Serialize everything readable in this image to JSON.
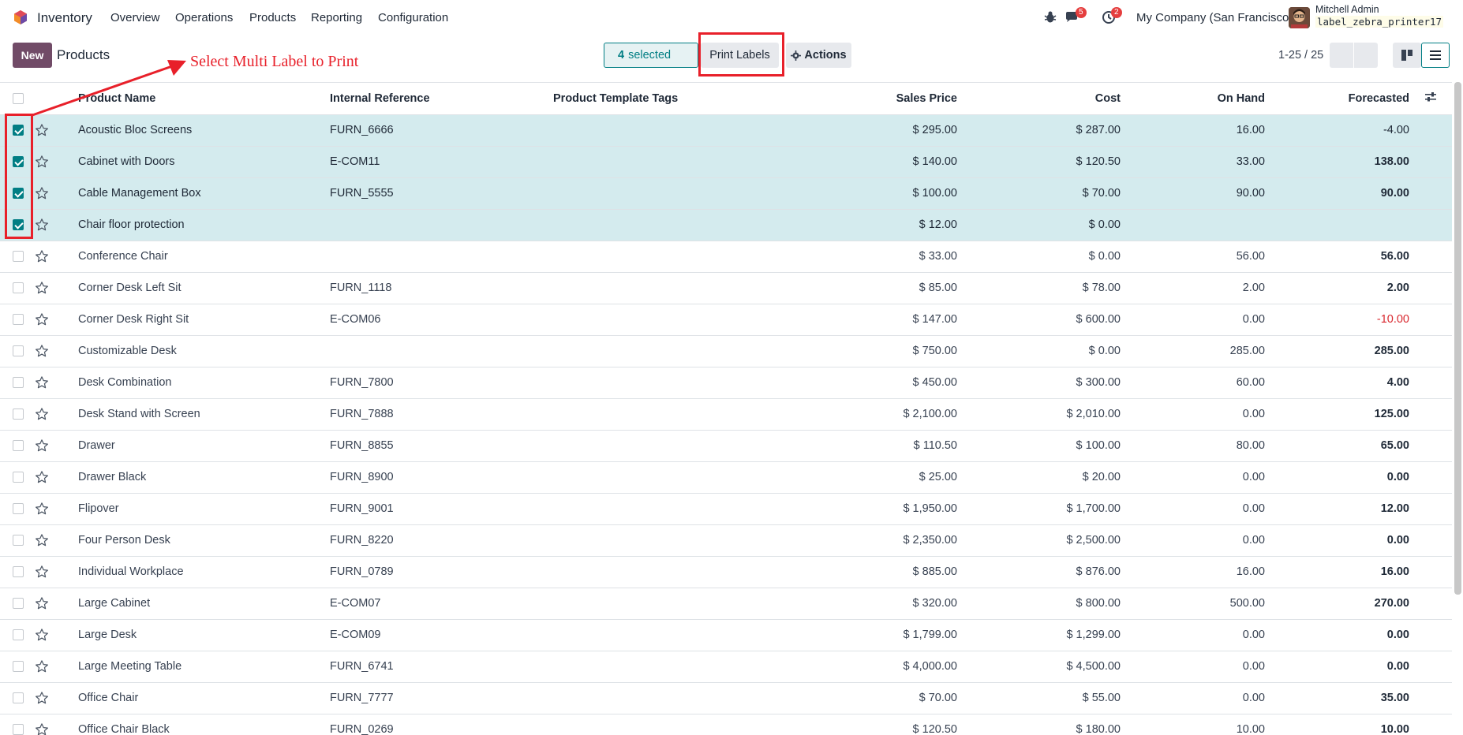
{
  "navbar": {
    "app_name": "Inventory",
    "menus": [
      "Overview",
      "Operations",
      "Products",
      "Reporting",
      "Configuration"
    ],
    "messages_badge": "5",
    "activities_badge": "2",
    "company": "My Company (San Francisco)",
    "user_name": "Mitchell Admin",
    "database": "label_zebra_printer17"
  },
  "control_panel": {
    "new_label": "New",
    "breadcrumb": "Products",
    "selected_count": "4",
    "selected_text": "selected",
    "print_labels": "Print Labels",
    "actions": "Actions",
    "pager": "1-25 / 25"
  },
  "annotation": {
    "text": "Select Multi Label to Print",
    "color": "#e8202a"
  },
  "table": {
    "headers": {
      "name": "Product Name",
      "ref": "Internal Reference",
      "tags": "Product Template Tags",
      "price": "Sales Price",
      "cost": "Cost",
      "onhand": "On Hand",
      "forecast": "Forecasted"
    },
    "rows": [
      {
        "name": "Acoustic Bloc Screens",
        "ref": "FURN_6666",
        "price": "$ 295.00",
        "cost": "$ 287.00",
        "onhand": "16.00",
        "forecast": "-4.00",
        "selected": true
      },
      {
        "name": "Cabinet with Doors",
        "ref": "E-COM11",
        "price": "$ 140.00",
        "cost": "$ 120.50",
        "onhand": "33.00",
        "forecast": "138.00",
        "selected": true
      },
      {
        "name": "Cable Management Box",
        "ref": "FURN_5555",
        "price": "$ 100.00",
        "cost": "$ 70.00",
        "onhand": "90.00",
        "forecast": "90.00",
        "selected": true
      },
      {
        "name": "Chair floor protection",
        "ref": "",
        "price": "$ 12.00",
        "cost": "$ 0.00",
        "onhand": "",
        "forecast": "",
        "selected": true
      },
      {
        "name": "Conference Chair",
        "ref": "",
        "price": "$ 33.00",
        "cost": "$ 0.00",
        "onhand": "56.00",
        "forecast": "56.00",
        "selected": false
      },
      {
        "name": "Corner Desk Left Sit",
        "ref": "FURN_1118",
        "price": "$ 85.00",
        "cost": "$ 78.00",
        "onhand": "2.00",
        "forecast": "2.00",
        "selected": false
      },
      {
        "name": "Corner Desk Right Sit",
        "ref": "E-COM06",
        "price": "$ 147.00",
        "cost": "$ 600.00",
        "onhand": "0.00",
        "forecast": "-10.00",
        "selected": false
      },
      {
        "name": "Customizable Desk",
        "ref": "",
        "price": "$ 750.00",
        "cost": "$ 0.00",
        "onhand": "285.00",
        "forecast": "285.00",
        "selected": false
      },
      {
        "name": "Desk Combination",
        "ref": "FURN_7800",
        "price": "$ 450.00",
        "cost": "$ 300.00",
        "onhand": "60.00",
        "forecast": "4.00",
        "selected": false
      },
      {
        "name": "Desk Stand with Screen",
        "ref": "FURN_7888",
        "price": "$ 2,100.00",
        "cost": "$ 2,010.00",
        "onhand": "0.00",
        "forecast": "125.00",
        "selected": false
      },
      {
        "name": "Drawer",
        "ref": "FURN_8855",
        "price": "$ 110.50",
        "cost": "$ 100.00",
        "onhand": "80.00",
        "forecast": "65.00",
        "selected": false
      },
      {
        "name": "Drawer Black",
        "ref": "FURN_8900",
        "price": "$ 25.00",
        "cost": "$ 20.00",
        "onhand": "0.00",
        "forecast": "0.00",
        "selected": false
      },
      {
        "name": "Flipover",
        "ref": "FURN_9001",
        "price": "$ 1,950.00",
        "cost": "$ 1,700.00",
        "onhand": "0.00",
        "forecast": "12.00",
        "selected": false
      },
      {
        "name": "Four Person Desk",
        "ref": "FURN_8220",
        "price": "$ 2,350.00",
        "cost": "$ 2,500.00",
        "onhand": "0.00",
        "forecast": "0.00",
        "selected": false
      },
      {
        "name": "Individual Workplace",
        "ref": "FURN_0789",
        "price": "$ 885.00",
        "cost": "$ 876.00",
        "onhand": "16.00",
        "forecast": "16.00",
        "selected": false
      },
      {
        "name": "Large Cabinet",
        "ref": "E-COM07",
        "price": "$ 320.00",
        "cost": "$ 800.00",
        "onhand": "500.00",
        "forecast": "270.00",
        "selected": false
      },
      {
        "name": "Large Desk",
        "ref": "E-COM09",
        "price": "$ 1,799.00",
        "cost": "$ 1,299.00",
        "onhand": "0.00",
        "forecast": "0.00",
        "selected": false
      },
      {
        "name": "Large Meeting Table",
        "ref": "FURN_6741",
        "price": "$ 4,000.00",
        "cost": "$ 4,500.00",
        "onhand": "0.00",
        "forecast": "0.00",
        "selected": false
      },
      {
        "name": "Office Chair",
        "ref": "FURN_7777",
        "price": "$ 70.00",
        "cost": "$ 55.00",
        "onhand": "0.00",
        "forecast": "35.00",
        "selected": false
      },
      {
        "name": "Office Chair Black",
        "ref": "FURN_0269",
        "price": "$ 120.50",
        "cost": "$ 180.00",
        "onhand": "10.00",
        "forecast": "10.00",
        "selected": false
      }
    ]
  }
}
